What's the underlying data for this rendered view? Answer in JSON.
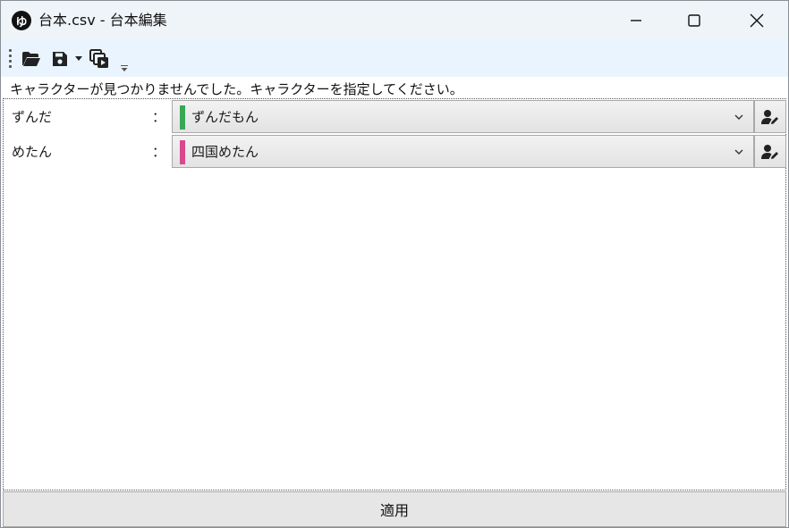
{
  "window": {
    "title": "台本.csv - 台本編集",
    "app_icon_glyph": "ゆ"
  },
  "toolbar": {
    "icons": [
      "folder-open-icon",
      "save-icon",
      "dropdown-caret-icon",
      "copy-play-icon",
      "overflow-chevron-icon"
    ]
  },
  "message": "キャラクターが見つかりませんでした。キャラクターを指定してください。",
  "mappings": [
    {
      "label": "ずんだ",
      "colon": "：",
      "selected": "ずんだもん",
      "color": "#3aa757"
    },
    {
      "label": "めたん",
      "colon": "：",
      "selected": "四国めたん",
      "color": "#d9478d"
    }
  ],
  "apply_label": "適用"
}
